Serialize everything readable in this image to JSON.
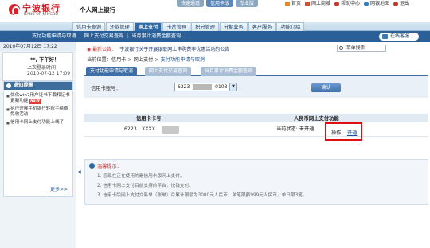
{
  "header": {
    "logo_cn": "宁波银行",
    "logo_en": "BANK OF NINGBO",
    "subtitle": "个人网上银行",
    "top_tabs": [
      "快速通道",
      "信用卡版",
      "专业版"
    ],
    "top_links": [
      "首页",
      "网上商城",
      "帮助中心",
      "网银地图",
      "退出"
    ]
  },
  "nav": {
    "items": [
      "信用卡查询",
      "还款管理",
      "网上支付",
      "卡片管理",
      "积分管理",
      "分期业务",
      "客户服务",
      "功能介绍"
    ],
    "active_index": 2,
    "sub_items": [
      "支付功能申请与取消",
      "网上支付交易查询",
      "当月累计消费金额查询"
    ],
    "service_btn": "在线客服"
  },
  "sidebar": {
    "datetime": "2010年07月12日 17:22",
    "greeting": "**, 下午好！",
    "last_login_label": "上次登录时间：",
    "last_login_value": "2010-07-12 17:09",
    "notice_title": "通知提醒",
    "notices": [
      "优化win7用户证书下载和证书更新功能",
      "执行开展手机银行转账手续费免收活动!",
      "信用卡网上支付功能上线了"
    ],
    "new_badge": "NEW",
    "more": "更多>>"
  },
  "main": {
    "news_label": "最新公告：",
    "news_text": "宁波银行关于开展银联网上申购费率优惠活动的公告",
    "search_placeholder": "菜单搜索",
    "breadcrumb_prefix": "当前位置：信用卡 > 网上支付 >",
    "breadcrumb_current": "支付功能申请与取消",
    "tabs": [
      "支付功能申请与取消",
      "网上支付交易查询",
      "当月累计消费金额查询"
    ],
    "account_label": "信用卡账号：",
    "account_prefix": "6223",
    "account_mid": "XXXX",
    "account_suffix": "0103",
    "query_btn": "确认",
    "table": {
      "col_card": "信用卡卡号",
      "col_status": "人民币网上支付功能",
      "card_prefix": "6223",
      "card_mid": "XXXX",
      "status": "当前状态: 未开通",
      "op_label": "操作:",
      "op_link": "开通"
    },
    "tips_title": "温馨提示：",
    "tips": [
      "1. 您现在正在使用的是信用卡版网上支付。",
      "2. 信用卡网上支付目前支持的平台：快钱支付。",
      "3. 信用卡版网上支付交易单（账单）月累计限额为3000元人民币，单笔限额999元人民币，单日限3笔。"
    ]
  }
}
